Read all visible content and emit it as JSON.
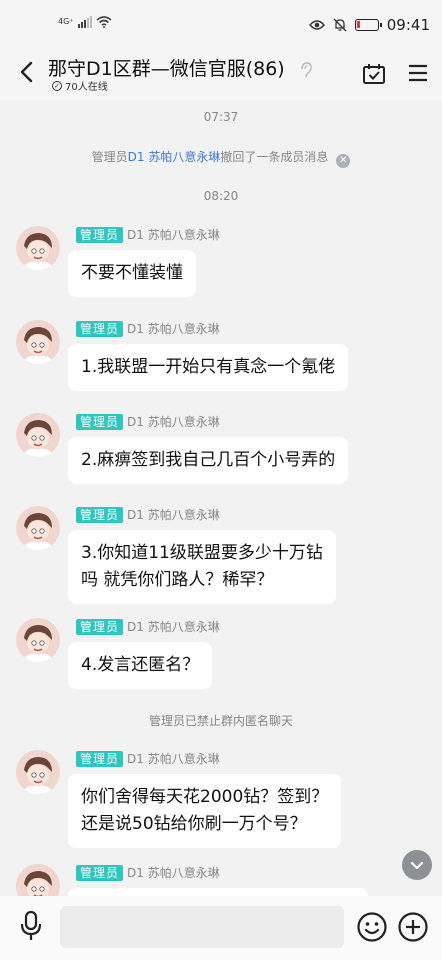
{
  "status_bar": {
    "network": "4G⁺",
    "time": "09:41"
  },
  "header": {
    "title": "那守D1区群—微信官服(86)",
    "online": "70人在线"
  },
  "chat": {
    "timestamps": [
      "07:37",
      "08:20"
    ],
    "recall_notice": {
      "prefix": "管理员",
      "name": "D1 苏帕八意永琳",
      "suffix": "撤回了一条成员消息"
    },
    "anon_notice": "管理员已禁止群内匿名聊天",
    "messages": [
      {
        "badge": "管理员",
        "sender": "D1 苏帕八意永琳",
        "text": "不要不懂装懂"
      },
      {
        "badge": "管理员",
        "sender": "D1 苏帕八意永琳",
        "text": "1.我联盟一开始只有真念一个氪佬"
      },
      {
        "badge": "管理员",
        "sender": "D1 苏帕八意永琳",
        "text": "2.麻痹签到我自己几百个小号弄的"
      },
      {
        "badge": "管理员",
        "sender": "D1 苏帕八意永琳",
        "line1": "3.你知道11级联盟要多少十万钻",
        "line2": "吗 就凭你们路人？稀罕？"
      },
      {
        "badge": "管理员",
        "sender": "D1 苏帕八意永琳",
        "text": "4.发言还匿名？"
      },
      {
        "badge": "管理员",
        "sender": "D1 苏帕八意永琳",
        "line1": "你们舍得每天花2000钻？签到？",
        "line2": "还是说50钻给你刷一万个号？"
      },
      {
        "badge": "管理员",
        "sender": "D1 苏帕八意永琳"
      }
    ]
  },
  "input": {
    "placeholder": ""
  },
  "colors": {
    "badge": "#2fc6c0",
    "link": "#3e7bd6",
    "background": "#f2f2f2"
  }
}
